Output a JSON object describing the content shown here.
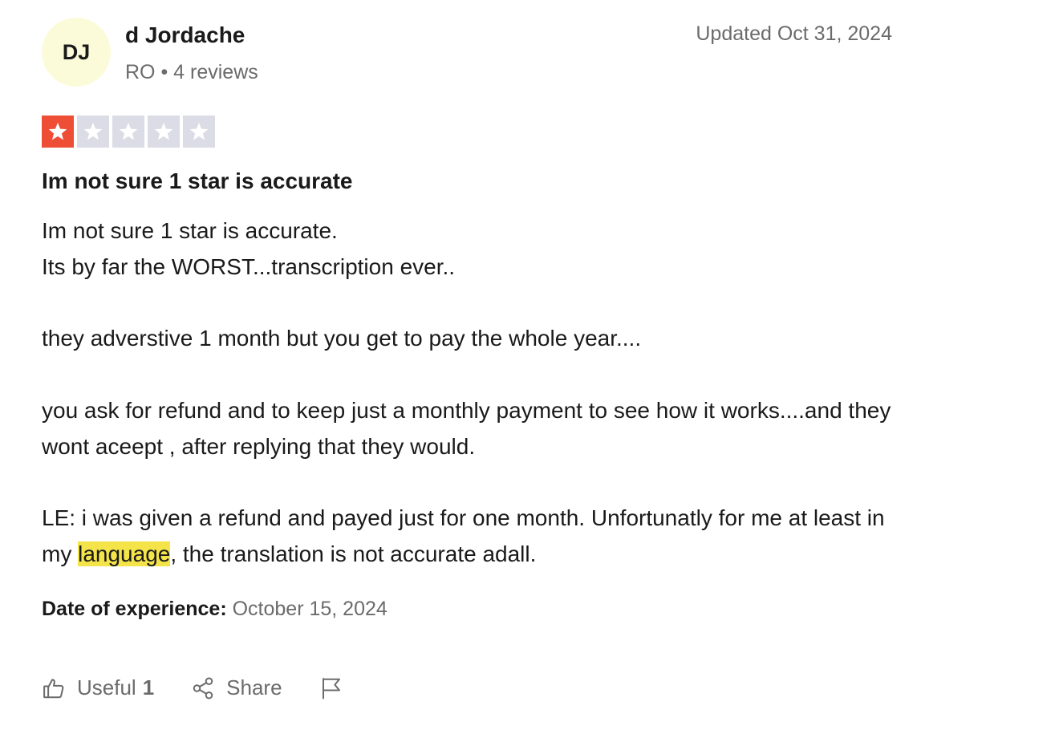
{
  "reviewer": {
    "initials": "DJ",
    "name": "d Jordache",
    "country": "RO",
    "reviews_count": "4 reviews"
  },
  "updated": "Updated Oct 31, 2024",
  "rating": {
    "value": 1,
    "max": 5,
    "filled_color": "#ee4e35",
    "empty_color": "#dcdce6"
  },
  "review": {
    "title": "Im not sure 1 star is accurate",
    "line1": "Im not sure 1 star is accurate.",
    "line2": "Its by far the WORST...transcription ever..",
    "para2": "they adverstive 1 month but you get to pay the whole year....",
    "para3": "you ask for refund and to keep just a monthly payment to see how it works....and they wont aceept , after replying that they would.",
    "para4_before": "LE: i was given a refund and payed just for one month. Unfortunatly for me at least in my ",
    "para4_highlight": "language",
    "para4_after": ", the translation is not accurate adall."
  },
  "experience": {
    "label": "Date of experience:",
    "date": "October 15, 2024"
  },
  "actions": {
    "useful_label": "Useful",
    "useful_count": "1",
    "share_label": "Share"
  },
  "icons": {
    "useful": "thumbs-up-icon",
    "share": "share-icon",
    "report": "flag-icon",
    "star": "star-icon"
  }
}
